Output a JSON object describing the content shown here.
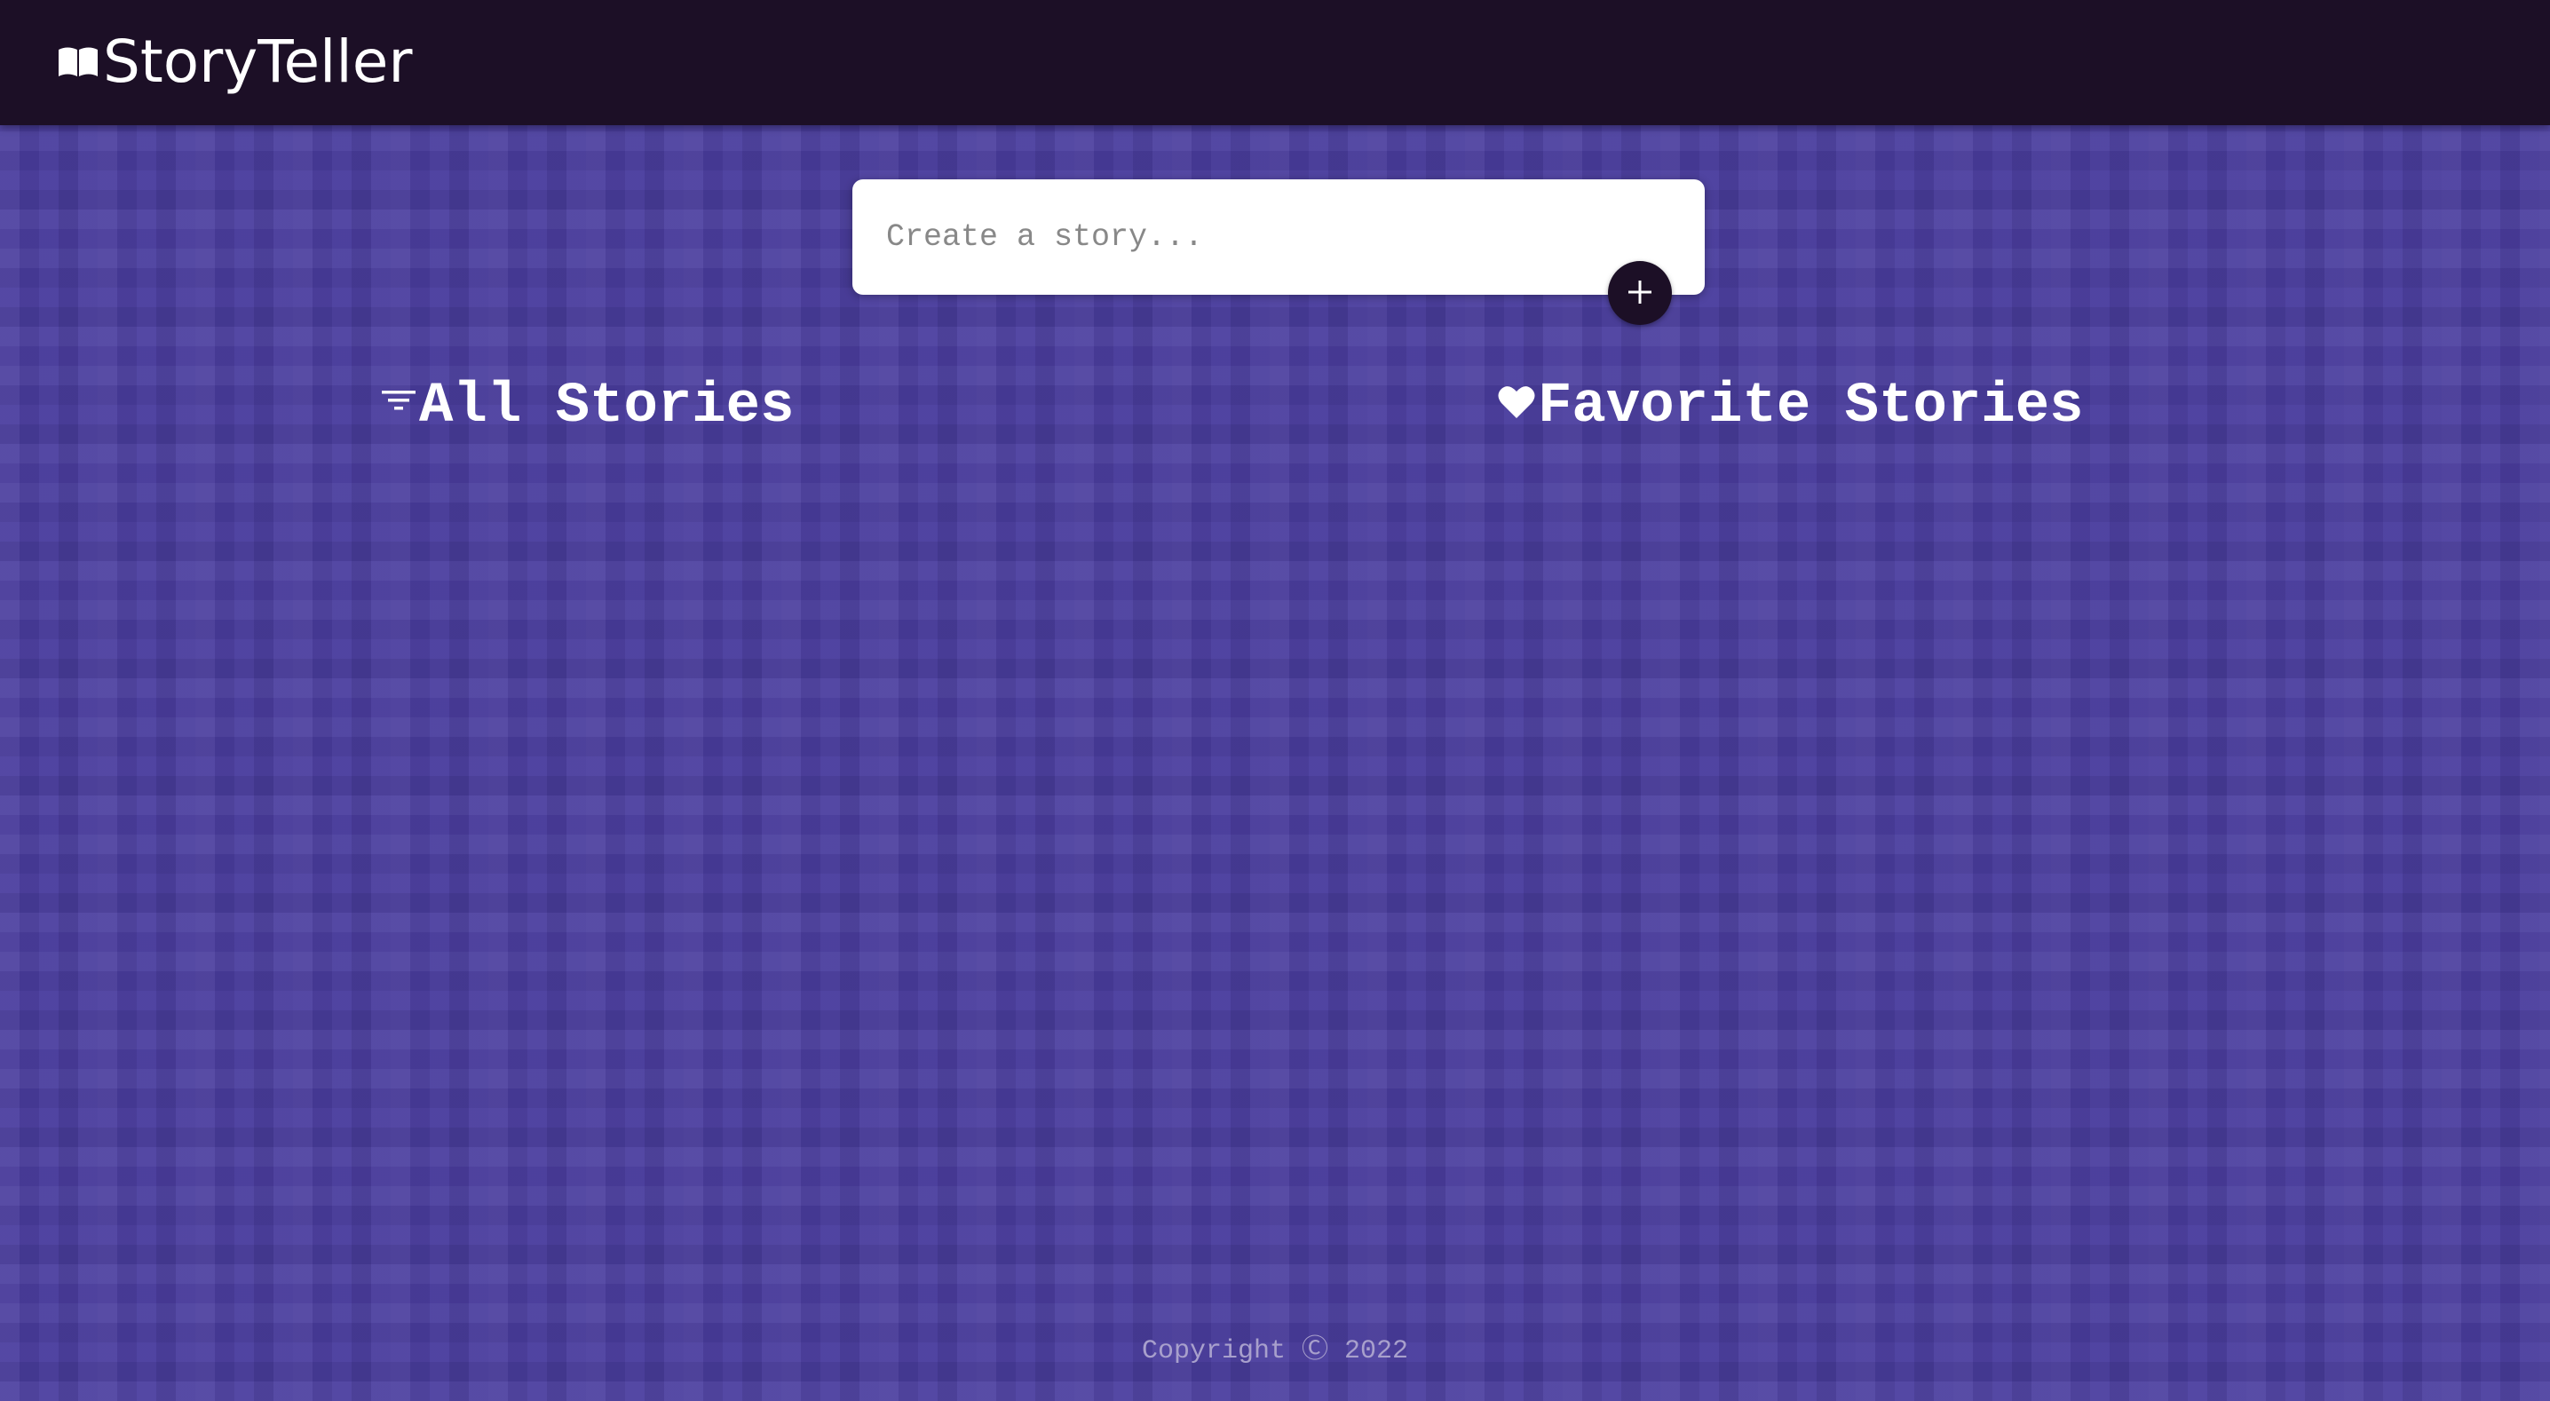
{
  "app": {
    "title": "StoryTeller",
    "logo_icon": "open-book-icon"
  },
  "create": {
    "placeholder": "Create a story...",
    "add_icon": "plus-icon"
  },
  "sections": {
    "all": {
      "title": "All Stories",
      "icon": "filter-icon"
    },
    "favorites": {
      "title": "Favorite Stories",
      "icon": "heart-icon"
    }
  },
  "footer": {
    "copyright": "Copyright Ⓒ 2022"
  },
  "colors": {
    "navbar": "#1c0f26",
    "background": "#4a3d9e",
    "text": "#ffffff",
    "footer_text": "#a8a0cc"
  }
}
